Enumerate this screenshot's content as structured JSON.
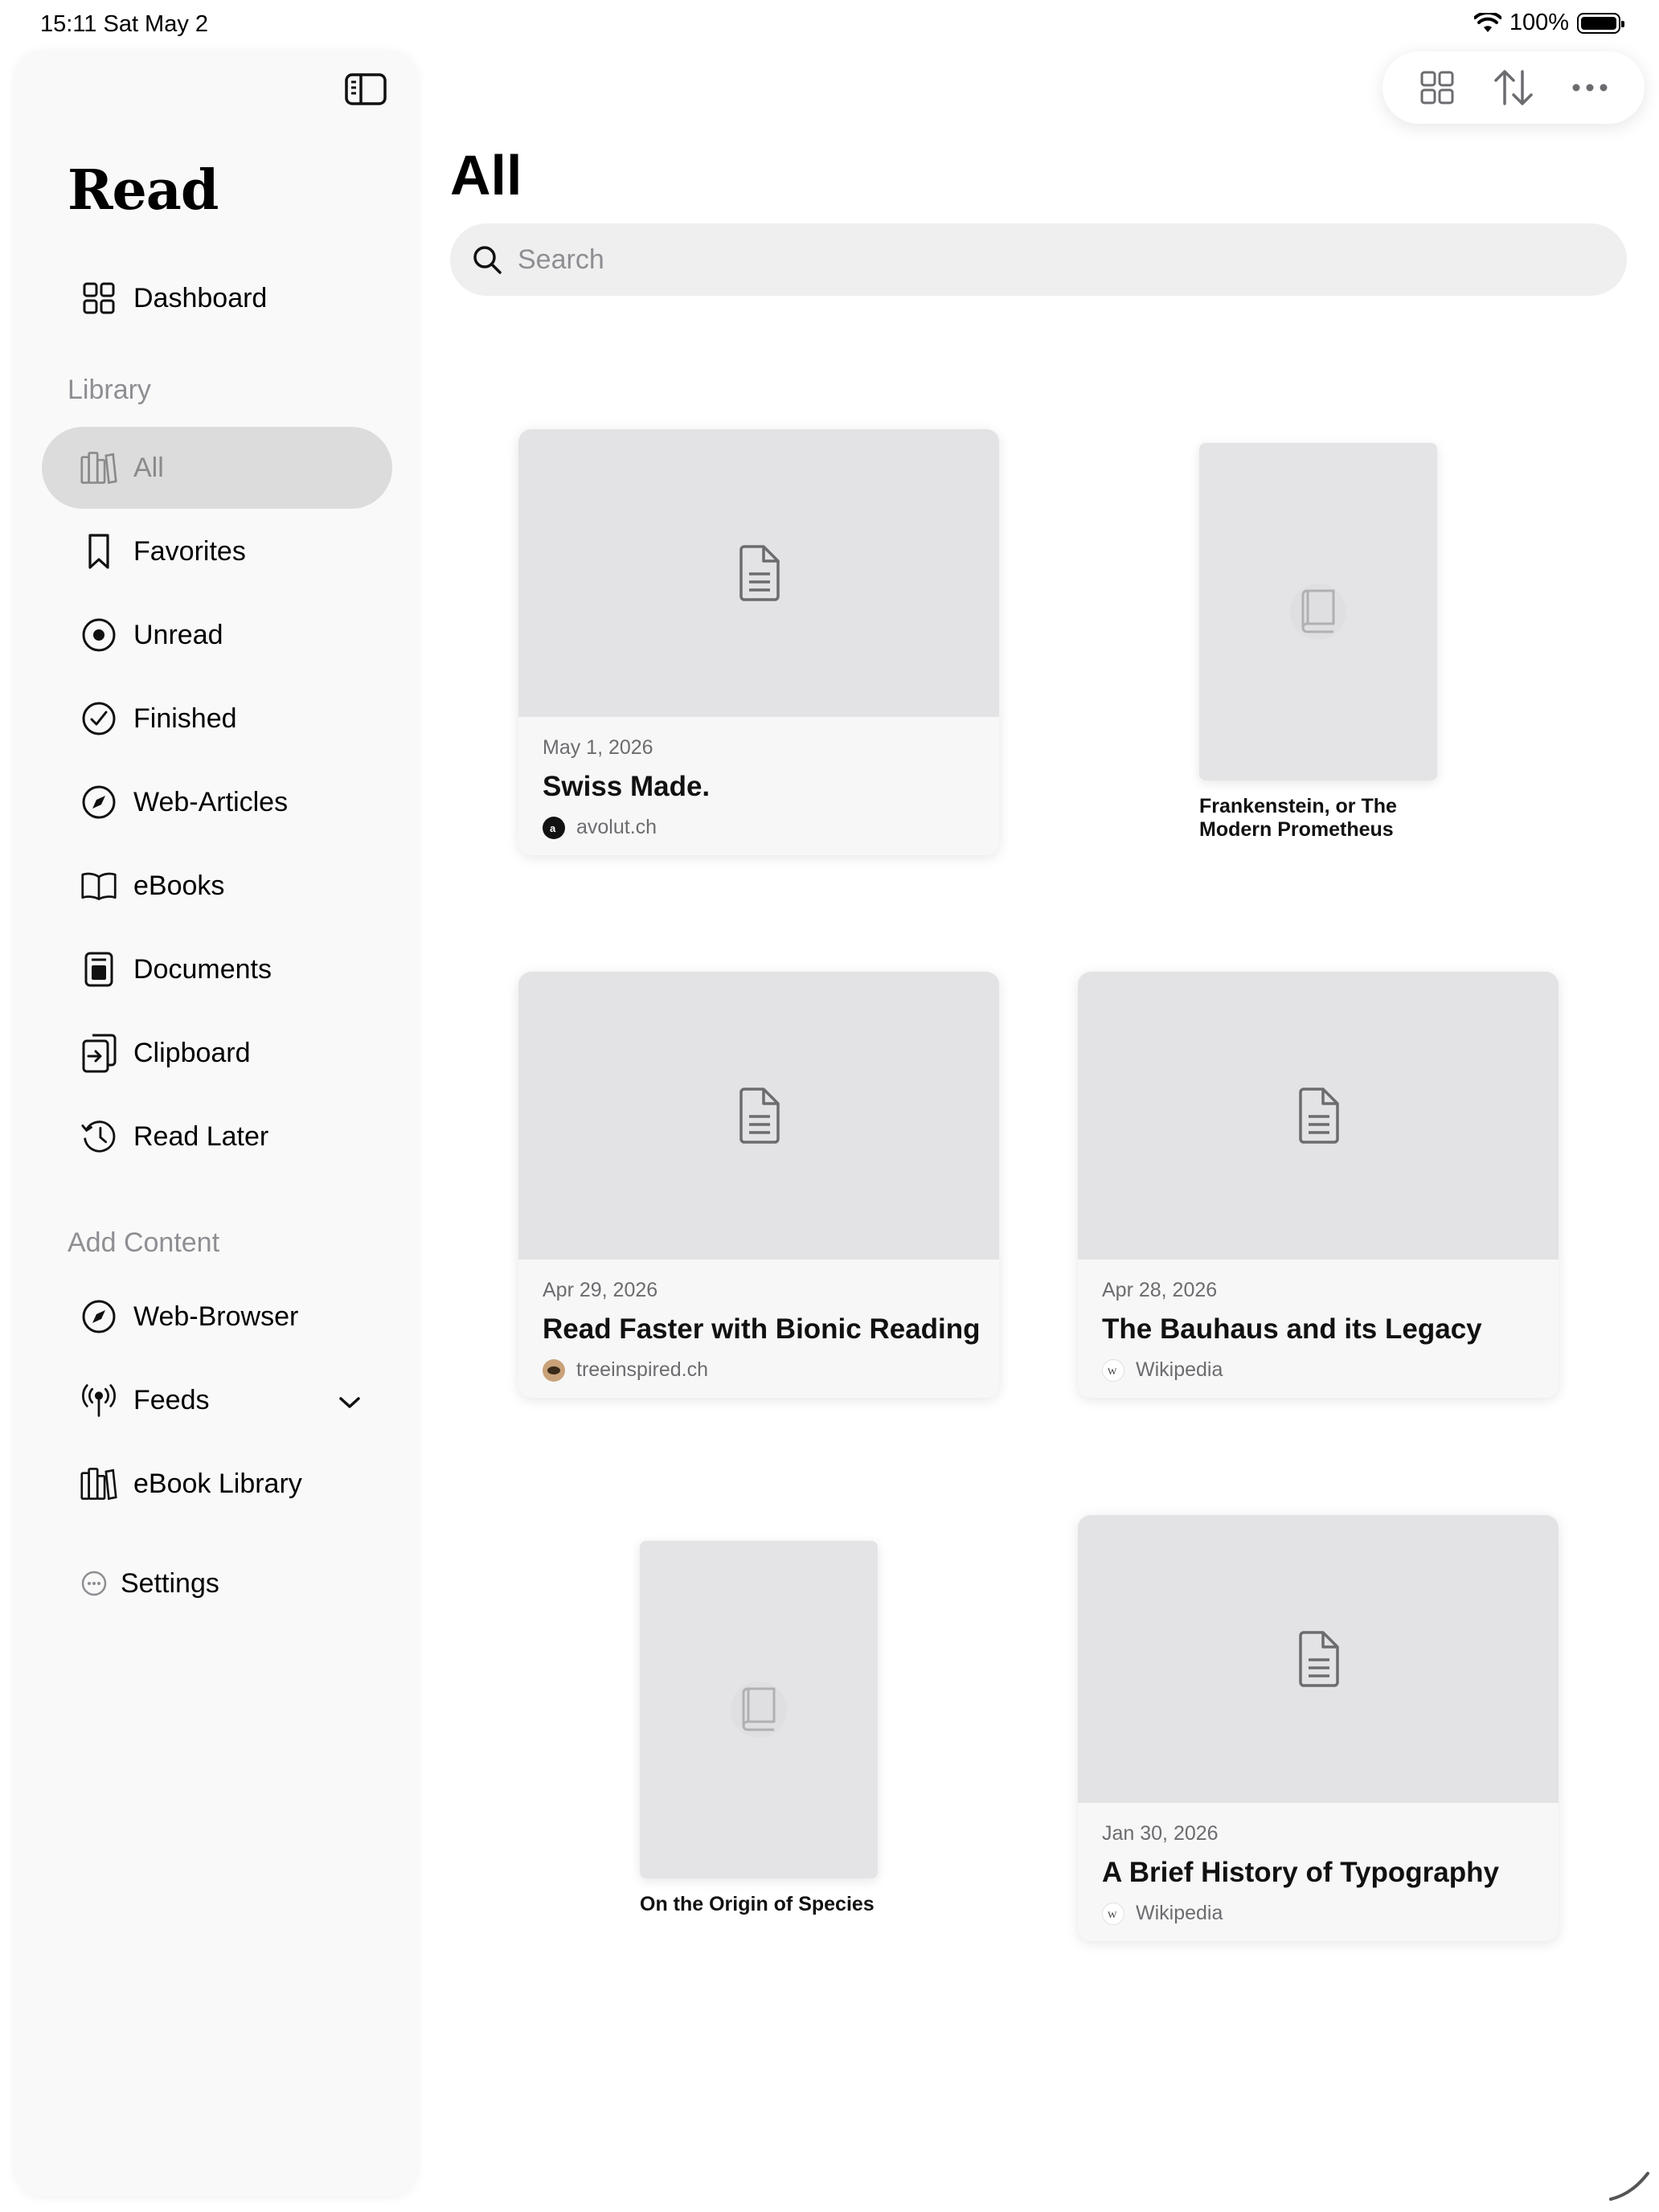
{
  "status_bar": {
    "time_date": "15:11   Sat May 2",
    "battery": "100%"
  },
  "sidebar": {
    "app_title": "Read",
    "dashboard": "Dashboard",
    "library_label": "Library",
    "library_items": [
      {
        "label": "All",
        "icon": "books-icon",
        "active": true
      },
      {
        "label": "Favorites",
        "icon": "bookmark-icon"
      },
      {
        "label": "Unread",
        "icon": "unread-dot-icon"
      },
      {
        "label": "Finished",
        "icon": "checkmark-circle-icon"
      },
      {
        "label": "Web-Articles",
        "icon": "compass-icon"
      },
      {
        "label": "eBooks",
        "icon": "open-book-icon"
      },
      {
        "label": "Documents",
        "icon": "document-icon"
      },
      {
        "label": "Clipboard",
        "icon": "clipboard-icon"
      },
      {
        "label": "Read Later",
        "icon": "clock-history-icon"
      }
    ],
    "add_content_label": "Add Content",
    "add_content_items": [
      {
        "label": "Web-Browser",
        "icon": "compass-icon"
      },
      {
        "label": "Feeds",
        "icon": "antenna-icon"
      },
      {
        "label": "eBook Library",
        "icon": "books-icon"
      }
    ],
    "settings": "Settings"
  },
  "main": {
    "title": "All",
    "search_placeholder": "Search",
    "articles": [
      {
        "date": "May 1, 2026",
        "title": "Swiss Made.",
        "source": "avolut.ch"
      },
      {
        "date": "Apr 29, 2026",
        "title": "Read Faster with Bionic Reading",
        "source": "treeinspired.ch"
      },
      {
        "date": "Apr 28, 2026",
        "title": "The Bauhaus and its Legacy",
        "source": "Wikipedia"
      },
      {
        "date": "Jan 30, 2026",
        "title": "A Brief History of Typography",
        "source": "Wikipedia"
      }
    ],
    "books": [
      {
        "title": "Frankenstein, or The Modern Prometheus"
      },
      {
        "title": "On the Origin of Species"
      }
    ]
  }
}
